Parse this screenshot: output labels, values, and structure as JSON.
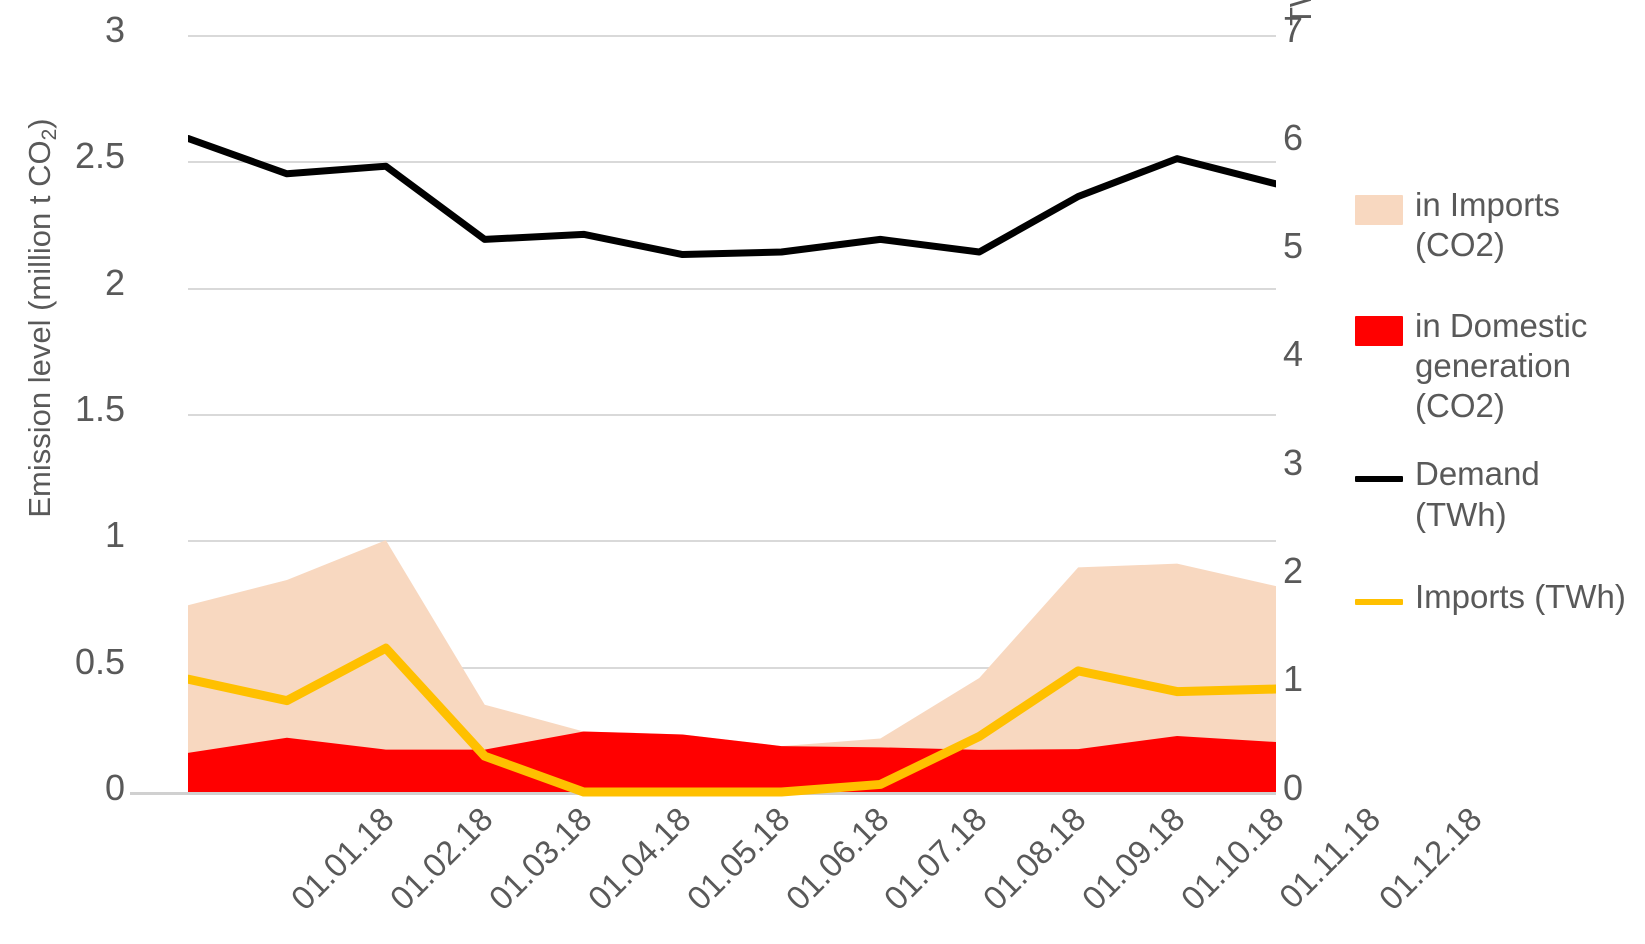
{
  "chart_data": {
    "type": "area",
    "title": "",
    "subtitle": "",
    "categories": [
      "01.01.18",
      "01.02.18",
      "01.03.18",
      "01.04.18",
      "01.05.18",
      "01.06.18",
      "01.07.18",
      "01.08.18",
      "01.09.18",
      "01.10.18",
      "01.11.18",
      "01.12.18"
    ],
    "xlabel": "",
    "ylabel": "Emission level  (million t CO2)",
    "y2label": "TWh",
    "ylim": [
      0,
      3
    ],
    "y2lim": [
      0,
      7
    ],
    "yticks": [
      "0",
      "0.5",
      "1",
      "1.5",
      "2",
      "2.5",
      "3"
    ],
    "y2ticks": [
      "0",
      "1",
      "2",
      "3",
      "4",
      "5",
      "6",
      "7"
    ],
    "grid": true,
    "legend_position": "right",
    "series": [
      {
        "name": "in Domestic generation (CO2)",
        "type": "area",
        "stacked": true,
        "axis": "left",
        "color": "#FF0000",
        "values": [
          0.155,
          0.215,
          0.168,
          0.168,
          0.24,
          0.228,
          0.182,
          0.177,
          0.167,
          0.17,
          0.222,
          0.198
        ]
      },
      {
        "name": "in Imports (CO2)",
        "type": "area",
        "stacked": true,
        "axis": "left",
        "color": "#F8D8C0",
        "values": [
          0.585,
          0.625,
          0.83,
          0.178,
          0.0,
          0.0,
          0.0,
          0.035,
          0.285,
          0.72,
          0.683,
          0.618
        ],
        "cumulative_top": [
          0.74,
          0.84,
          0.998,
          0.346,
          0.24,
          0.228,
          0.182,
          0.212,
          0.452,
          0.89,
          0.905,
          0.816
        ]
      },
      {
        "name": "Demand (TWh)",
        "type": "line",
        "axis": "right",
        "color": "#000000",
        "values": [
          6.05,
          5.72,
          5.79,
          5.11,
          5.15,
          4.97,
          5.0,
          5.11,
          4.99,
          5.51,
          5.86,
          5.62
        ],
        "values_left_scale": [
          2.59,
          2.45,
          2.48,
          2.19,
          2.21,
          2.13,
          2.14,
          2.19,
          2.14,
          2.36,
          2.51,
          2.41
        ]
      },
      {
        "name": "Imports (TWh)",
        "type": "line",
        "axis": "right",
        "color": "#FFC000",
        "values": [
          1.04,
          0.84,
          1.33,
          0.33,
          0.0,
          0.0,
          0.0,
          0.07,
          0.51,
          1.12,
          0.93,
          0.95
        ],
        "values_left_scale": [
          0.447,
          0.362,
          0.57,
          0.142,
          0.0,
          0.0,
          0.0,
          0.03,
          0.22,
          0.48,
          0.398,
          0.408
        ]
      }
    ]
  },
  "axes": {
    "left_title_main": "Emission level  (million t CO",
    "left_title_sub": "2",
    "left_title_close": ")",
    "right_title": "TWh"
  },
  "legend": {
    "items": [
      {
        "label": "in Imports (CO2)",
        "swatch": "box",
        "color": "#F8D8C0"
      },
      {
        "label": "in Domestic generation (CO2)",
        "swatch": "box",
        "color": "#FF0000"
      },
      {
        "label": "Demand (TWh)",
        "swatch": "line",
        "color": "#000000"
      },
      {
        "label": "Imports (TWh)",
        "swatch": "line",
        "color": "#FFC000"
      }
    ]
  },
  "colors": {
    "imports_area": "#F8D8C0",
    "domestic_area": "#FF0000",
    "demand_line": "#000000",
    "imports_line": "#FFC000",
    "grid": "#D9D9D9",
    "text": "#595959"
  }
}
